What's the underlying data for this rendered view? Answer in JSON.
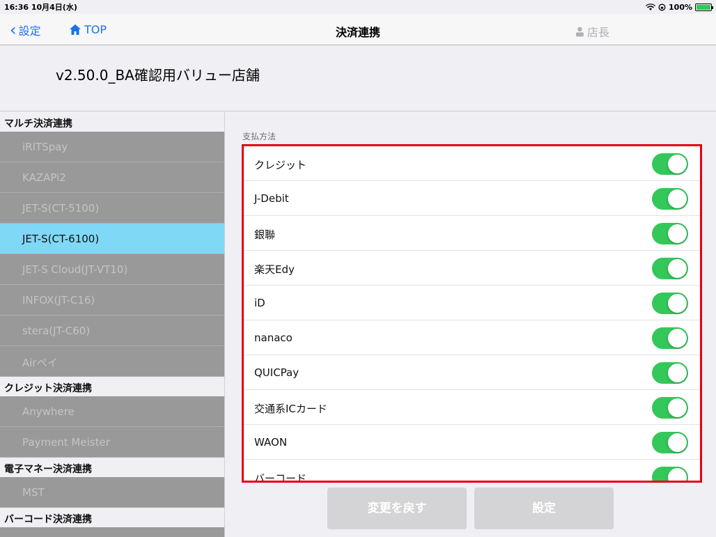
{
  "status_bar": {
    "time_date": "16:36  10月4日(水)",
    "battery_label": "100%",
    "icons": [
      "wifi-icon",
      "orientation-lock-icon",
      "battery-icon"
    ]
  },
  "nav": {
    "back_label": "設定",
    "top_label": "TOP",
    "title": "決済連携",
    "user_label": "店長"
  },
  "store": {
    "name": "v2.50.0_BA確認用バリュー店舗"
  },
  "sidebar": {
    "sections": [
      {
        "title": "マルチ決済連携",
        "items": [
          "iRITSpay",
          "KAZAPi2",
          "JET-S(CT-5100)",
          "JET-S(CT-6100)",
          "JET-S Cloud(JT-VT10)",
          "INFOX(JT-C16)",
          "stera(JT-C60)",
          "Airペイ"
        ]
      },
      {
        "title": "クレジット決済連携",
        "items": [
          "Anywhere",
          "Payment Meister"
        ]
      },
      {
        "title": "電子マネー決済連携",
        "items": [
          "MST"
        ]
      },
      {
        "title": "バーコード決済連携",
        "items": []
      }
    ],
    "selected": "JET-S(CT-6100)"
  },
  "main": {
    "section_label": "支払方法",
    "payment_methods": [
      {
        "label": "クレジット",
        "enabled": true
      },
      {
        "label": "J-Debit",
        "enabled": true
      },
      {
        "label": "銀聯",
        "enabled": true
      },
      {
        "label": "楽天Edy",
        "enabled": true
      },
      {
        "label": "iD",
        "enabled": true
      },
      {
        "label": "nanaco",
        "enabled": true
      },
      {
        "label": "QUICPay",
        "enabled": true
      },
      {
        "label": "交通系ICカード",
        "enabled": true
      },
      {
        "label": "WAON",
        "enabled": true
      },
      {
        "label": "バーコード",
        "enabled": true
      }
    ],
    "buttons": {
      "revert": "変更を戻す",
      "save": "設定"
    }
  },
  "colors": {
    "accent": "#1a73e8",
    "toggle_on": "#34c759",
    "selected_row": "#7fd8f6",
    "highlight_border": "#e60012"
  }
}
